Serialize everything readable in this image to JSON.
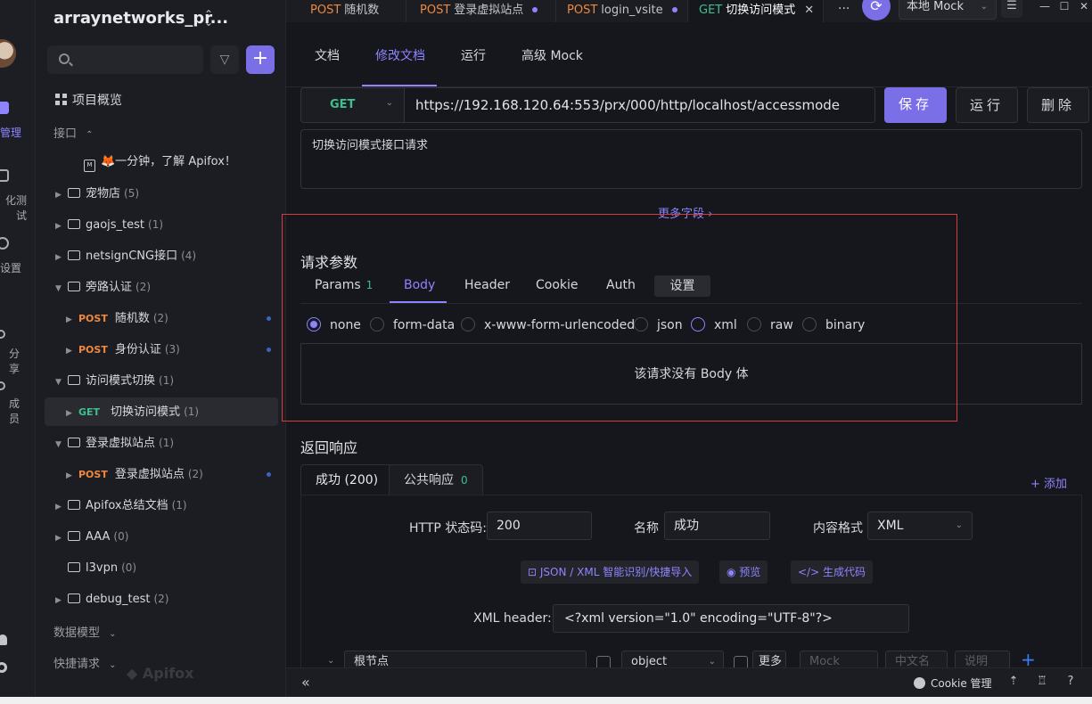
{
  "app": {
    "project_title": "arraynetworks_pr...",
    "accent_color": "#8e84ff",
    "watermark": "Apifox"
  },
  "rail": {
    "items": [
      {
        "label": "管理",
        "icon": "api-manage-icon",
        "active": true
      },
      {
        "label": "化测试",
        "icon": "automation-test-icon"
      },
      {
        "label": "设置",
        "icon": "settings-icon"
      },
      {
        "label": "分享",
        "icon": "share-icon"
      },
      {
        "label": "成员",
        "icon": "members-icon"
      }
    ]
  },
  "sidebar": {
    "search_placeholder": "",
    "overview": "项目概览",
    "interfaces_label": "接口",
    "data_models_label": "数据模型",
    "quick_requests_label": "快捷请求",
    "tree": [
      {
        "type": "doc",
        "label": "🦊一分钟，了解 Apifox！",
        "indent": 1
      },
      {
        "type": "folder",
        "label": "宠物店",
        "count": "(5)",
        "expanded": false,
        "indent": 0
      },
      {
        "type": "folder",
        "label": "gaojs_test",
        "count": "(1)",
        "expanded": false,
        "indent": 0
      },
      {
        "type": "folder",
        "label": "netsignCNG接口",
        "count": "(4)",
        "expanded": false,
        "indent": 0
      },
      {
        "type": "folder",
        "label": "旁路认证",
        "count": "(2)",
        "expanded": true,
        "indent": 0
      },
      {
        "type": "api",
        "method": "POST",
        "label": "随机数",
        "count": "(2)",
        "indent": 1,
        "dot": true
      },
      {
        "type": "api",
        "method": "POST",
        "label": "身份认证",
        "count": "(3)",
        "indent": 1,
        "dot": true
      },
      {
        "type": "folder",
        "label": "访问模式切换",
        "count": "(1)",
        "expanded": true,
        "indent": 0
      },
      {
        "type": "api",
        "method": "GET",
        "label": "切换访问模式",
        "count": "(1)",
        "indent": 1,
        "selected": true
      },
      {
        "type": "folder",
        "label": "登录虚拟站点",
        "count": "(1)",
        "expanded": true,
        "indent": 0
      },
      {
        "type": "api",
        "method": "POST",
        "label": "登录虚拟站点",
        "count": "(2)",
        "indent": 1,
        "dot": true
      },
      {
        "type": "folder",
        "label": "Apifox总结文档",
        "count": "(1)",
        "expanded": false,
        "indent": 0
      },
      {
        "type": "folder",
        "label": "AAA",
        "count": "(0)",
        "expanded": false,
        "indent": 0
      },
      {
        "type": "folder",
        "label": "l3vpn",
        "count": "(0)",
        "expanded": null,
        "indent": 0
      },
      {
        "type": "folder",
        "label": "debug_test",
        "count": "(2)",
        "expanded": false,
        "indent": 0
      }
    ]
  },
  "tabs": [
    {
      "method": "POST",
      "label": "随机数",
      "unsaved": false
    },
    {
      "method": "POST",
      "label": "登录虚拟站点",
      "unsaved": true
    },
    {
      "method": "POST",
      "label": "login_vsite",
      "unsaved": true
    },
    {
      "method": "GET",
      "label": "切换访问模式",
      "active": true
    }
  ],
  "topbar": {
    "more": "···",
    "mock_env": "本地 Mock"
  },
  "subtabs": [
    "文档",
    "修改文档",
    "运行",
    "高级 Mock"
  ],
  "request": {
    "method": "GET",
    "url": "https://192.168.120.64:553/prx/000/http/localhost/accessmode",
    "save_label": "保存",
    "run_label": "运行",
    "delete_label": "删除",
    "description": "切换访问模式接口请求",
    "more_fields": "更多字段 ›"
  },
  "params": {
    "title": "请求参数",
    "tabs": [
      {
        "label": "Params",
        "badge": "1"
      },
      {
        "label": "Body",
        "active": true
      },
      {
        "label": "Header"
      },
      {
        "label": "Cookie"
      },
      {
        "label": "Auth"
      },
      {
        "label": "设置"
      }
    ],
    "body_types": [
      "none",
      "form-data",
      "x-www-form-urlencoded",
      "json",
      "xml",
      "raw",
      "binary"
    ],
    "selected_body_type": "none",
    "no_body_text": "该请求没有 Body 体"
  },
  "response": {
    "title": "返回响应",
    "tabs": [
      {
        "label": "成功 (200)",
        "active": true
      },
      {
        "label": "公共响应",
        "badge": "0"
      }
    ],
    "add_label": "+ 添加",
    "status_label": "HTTP 状态码:",
    "status_value": "200",
    "name_label": "名称",
    "name_value": "成功",
    "content_type_label": "内容格式",
    "content_type_value": "XML",
    "actions": [
      "JSON / XML 智能识别/快捷导入",
      "预览",
      "生成代码"
    ],
    "xml_header_label": "XML header:",
    "xml_header_value": "<?xml version=\"1.0\" encoding=\"UTF-8\"?>",
    "root_node": {
      "name": "根节点",
      "type": "object",
      "more_label": "更多",
      "mock_placeholder": "Mock",
      "cn_name_placeholder": "中文名",
      "desc_placeholder": "说明"
    }
  },
  "statusbar": {
    "cookie_label": "Cookie 管理"
  }
}
